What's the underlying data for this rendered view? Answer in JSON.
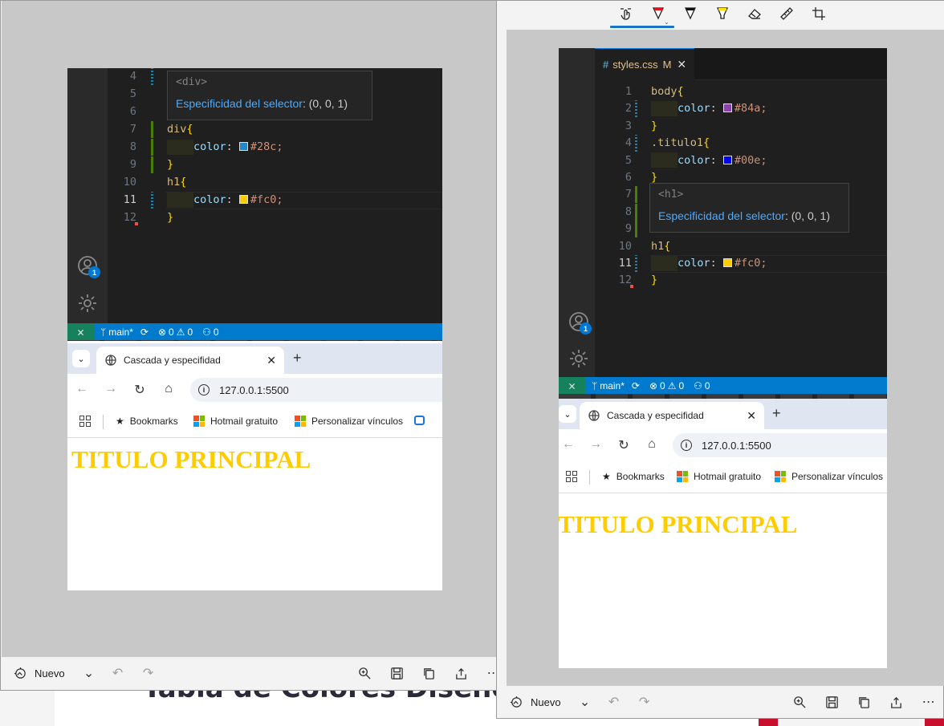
{
  "background_page": {
    "heading": "Tabla de Colores Diseño Pá"
  },
  "snip_toolbar": {
    "tools": [
      "touch-writing-icon",
      "ballpoint-pen-icon",
      "pen-icon",
      "highlighter-icon",
      "eraser-icon",
      "ruler-icon",
      "crop-icon"
    ]
  },
  "snip_bottom": {
    "new_label": "Nuevo"
  },
  "left_shot": {
    "code": [
      {
        "n": "4"
      },
      {
        "n": "5"
      },
      {
        "n": "6"
      },
      {
        "n": "7",
        "sel": "div",
        "brace": "{"
      },
      {
        "n": "8",
        "prop": "color",
        "color": "#28c",
        "value": "#28c;"
      },
      {
        "n": "9",
        "brace": "}"
      },
      {
        "n": "10",
        "sel": "h1",
        "brace": "{"
      },
      {
        "n": "11",
        "prop": "color",
        "color": "#fc0",
        "value": "#fc0;"
      },
      {
        "n": "12",
        "brace": "}"
      }
    ],
    "hover": {
      "tag": "<div>",
      "link": "Especificidad del selector",
      "value": ": (0, 0, 1)"
    },
    "statusbar": {
      "branch": "main*",
      "errors": "0",
      "warnings": "0",
      "ports": "0"
    },
    "account_badge": "1"
  },
  "right_shot": {
    "file_tab": {
      "name": "styles.css",
      "modified": "M"
    },
    "code": [
      {
        "n": "1",
        "sel": "body",
        "brace": "{"
      },
      {
        "n": "2",
        "prop": "color",
        "color": "#84a",
        "value": "#84a;"
      },
      {
        "n": "3",
        "brace": "}"
      },
      {
        "n": "4",
        "sel": ".titulo1",
        "brace": "{"
      },
      {
        "n": "5",
        "prop": "color",
        "color": "#00e",
        "value": "#00e;"
      },
      {
        "n": "6",
        "brace": "}"
      },
      {
        "n": "7"
      },
      {
        "n": "8"
      },
      {
        "n": "9"
      },
      {
        "n": "10",
        "sel": "h1",
        "brace": "{"
      },
      {
        "n": "11",
        "prop": "color",
        "color": "#fc0",
        "value": "#fc0;"
      },
      {
        "n": "12",
        "brace": "}"
      }
    ],
    "hover": {
      "tag": "<h1>",
      "link": "Especificidad del selector",
      "value": ": (0, 0, 1)"
    },
    "statusbar": {
      "branch": "main*",
      "errors": "0",
      "warnings": "0",
      "ports": "0"
    },
    "account_badge": "1"
  },
  "browser": {
    "tab_title": "Cascada y especifidad",
    "url": "127.0.0.1:5500",
    "bookmarks": [
      "Bookmarks",
      "Hotmail gratuito",
      "Personalizar vínculos"
    ],
    "page_heading": "TITULO PRINCIPAL"
  },
  "colors": {
    "heading_yellow": "#ffcc00",
    "vscode_status": "#007acc",
    "remote_green": "#16825d"
  }
}
